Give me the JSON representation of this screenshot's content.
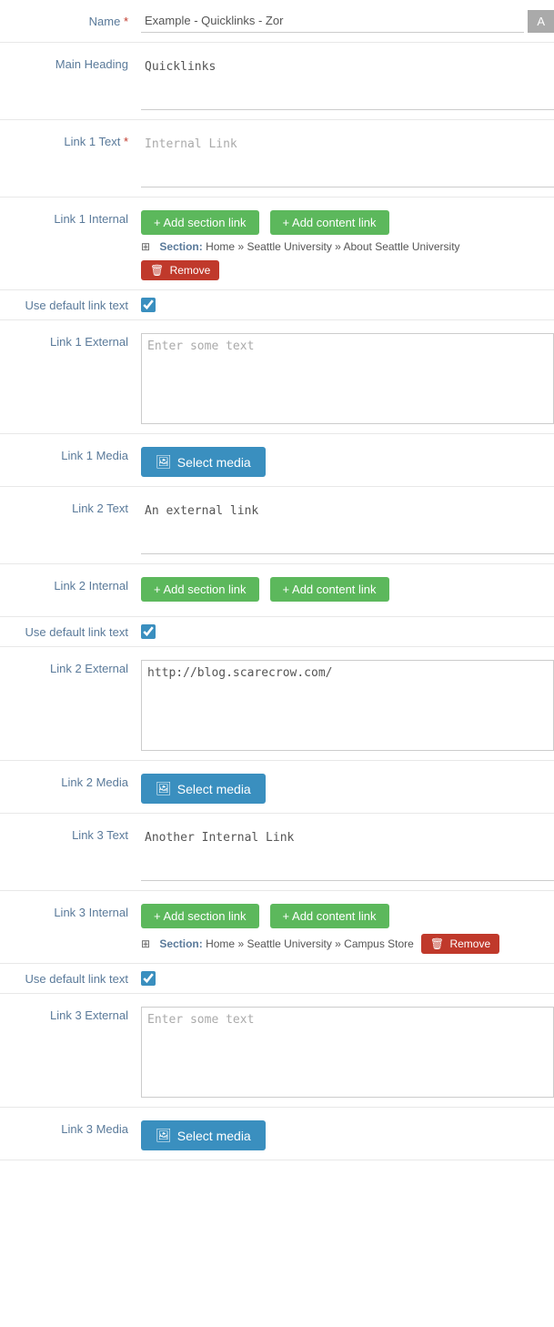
{
  "fields": {
    "name": {
      "label": "Name",
      "required": true,
      "value": "Example - Quicklinks - Zor",
      "placeholder": "Example - Quicklinks - Zor"
    },
    "mainHeading": {
      "label": "Main Heading",
      "value": "Quicklinks",
      "placeholder": ""
    },
    "link1Text": {
      "label": "Link 1 Text",
      "required": true,
      "value": "Internal Link",
      "placeholder": "Internal Link"
    },
    "link1Internal": {
      "label": "Link 1 Internal",
      "addSectionLabel": "+ Add section link",
      "addContentLabel": "+ Add content link",
      "section": {
        "prefix": "Section:",
        "path": "Home » Seattle University » About Seattle University"
      },
      "removeLabel": "Remove"
    },
    "useDefaultLinkText1": {
      "label": "Use default link text",
      "checked": true
    },
    "link1External": {
      "label": "Link 1 External",
      "placeholder": "Enter some text",
      "value": ""
    },
    "link1Media": {
      "label": "Link 1 Media",
      "buttonLabel": "Select media"
    },
    "link2Text": {
      "label": "Link 2 Text",
      "value": "An external link",
      "placeholder": ""
    },
    "link2Internal": {
      "label": "Link 2 Internal",
      "addSectionLabel": "+ Add section link",
      "addContentLabel": "+ Add content link"
    },
    "useDefaultLinkText2": {
      "label": "Use default link text",
      "checked": true
    },
    "link2External": {
      "label": "Link 2 External",
      "placeholder": "",
      "value": "http://blog.scarecrow.com/"
    },
    "link2Media": {
      "label": "Link 2 Media",
      "buttonLabel": "Select media"
    },
    "link3Text": {
      "label": "Link 3 Text",
      "value": "Another Internal Link",
      "placeholder": ""
    },
    "link3Internal": {
      "label": "Link 3 Internal",
      "addSectionLabel": "+ Add section link",
      "addContentLabel": "+ Add content link",
      "section": {
        "prefix": "Section:",
        "path": "Home » Seattle University » Campus Store"
      },
      "removeLabel": "Remove"
    },
    "useDefaultLinkText3": {
      "label": "Use default link text",
      "checked": true
    },
    "link3External": {
      "label": "Link 3 External",
      "placeholder": "Enter some text",
      "value": ""
    },
    "link3Media": {
      "label": "Link 3 Media",
      "buttonLabel": "Select media"
    }
  }
}
